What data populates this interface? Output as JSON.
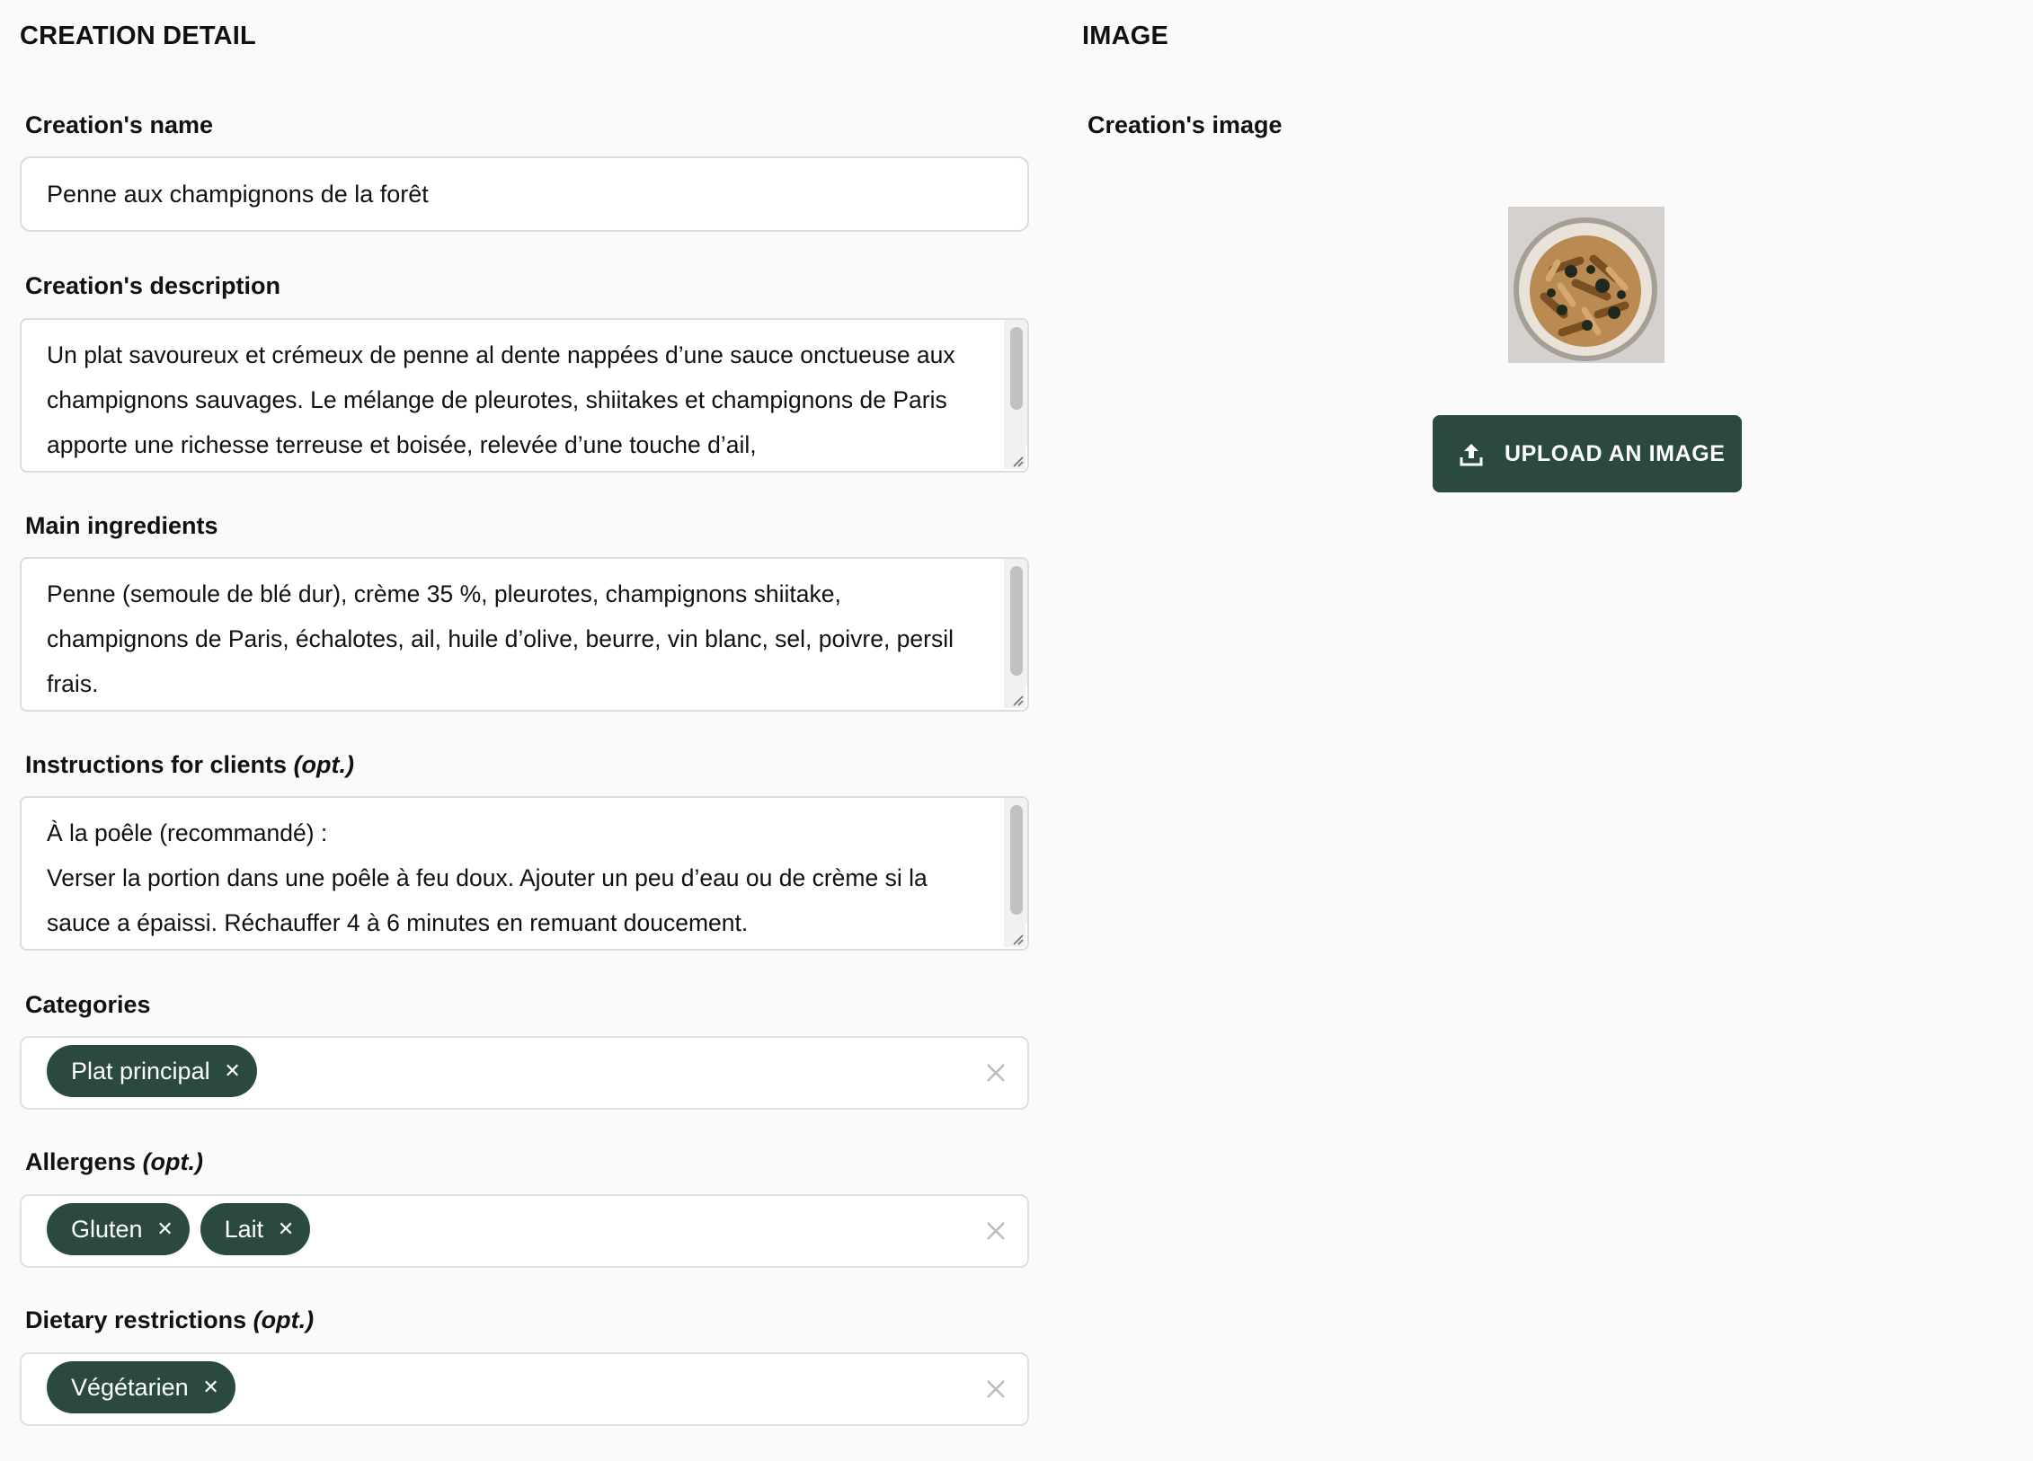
{
  "creation_detail": {
    "title": "CREATION DETAIL",
    "name": {
      "label": "Creation's name",
      "value": "Penne aux champignons de la forêt"
    },
    "description": {
      "label": "Creation's description",
      "value": "Un plat savoureux et crémeux de penne al dente nappées d’une sauce onctueuse aux champignons sauvages. Le mélange de pleurotes, shiitakes et champignons de Paris apporte une richesse terreuse et boisée, relevée d’une touche d’ail,"
    },
    "ingredients": {
      "label": "Main ingredients",
      "value": "Penne (semoule de blé dur), crème 35 %, pleurotes, champignons shiitake, champignons de Paris, échalotes, ail, huile d’olive, beurre, vin blanc, sel, poivre, persil frais."
    },
    "instructions": {
      "label": "Instructions for clients",
      "opt": "(opt.)",
      "value": "À la poêle (recommandé) :\nVerser la portion dans une poêle à feu doux. Ajouter un peu d’eau ou de crème si la sauce a épaissi. Réchauffer 4 à 6 minutes en remuant doucement."
    },
    "categories": {
      "label": "Categories",
      "chips": [
        "Plat principal"
      ]
    },
    "allergens": {
      "label": "Allergens",
      "opt": "(opt.)",
      "chips": [
        "Gluten",
        "Lait"
      ]
    },
    "dietary": {
      "label": "Dietary restrictions",
      "opt": "(opt.)",
      "chips": [
        "Végétarien"
      ]
    }
  },
  "image_section": {
    "title": "IMAGE",
    "label": "Creation's image",
    "upload_button": "UPLOAD AN IMAGE",
    "upload_icon": "upload-icon"
  },
  "colors": {
    "accent": "#2a4a40",
    "background": "#fafafa",
    "border": "#dcdcdc"
  }
}
